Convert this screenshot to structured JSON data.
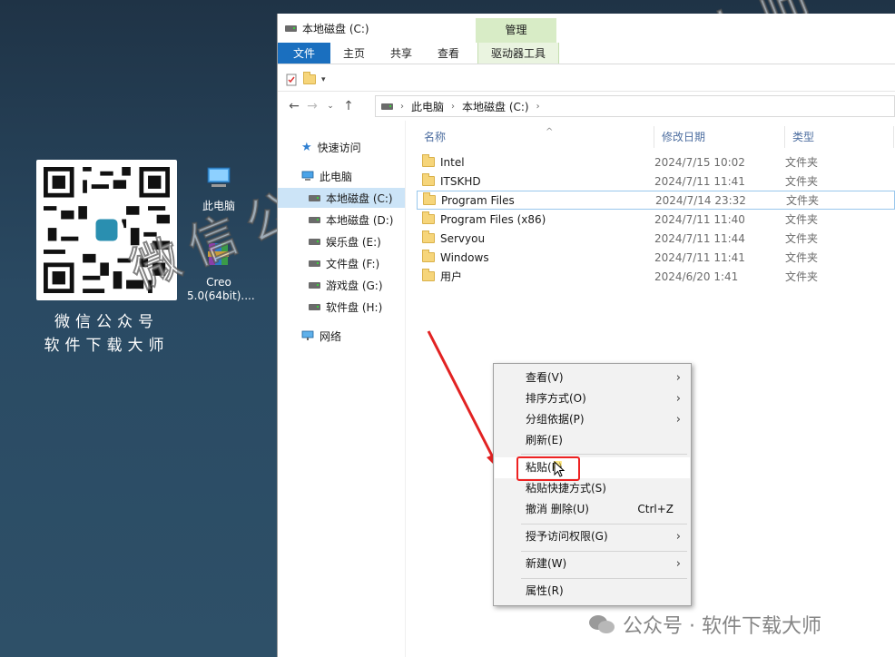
{
  "desktop": {
    "qr_caption_line1": "微信公众号",
    "qr_caption_line2": "软件下载大师",
    "icons": [
      {
        "label": "此电脑",
        "icon": "computer-icon"
      },
      {
        "label": "Creo 5.0(64bit)....",
        "icon": "winrar-archive-icon"
      }
    ],
    "watermark_text": "微信公众号：软件下载大师",
    "footer_watermark": "公众号 · 软件下载大师"
  },
  "window": {
    "title": "本地磁盘 (C:)",
    "context_tab_header": "管理",
    "ribbon_tabs": [
      "文件",
      "主页",
      "共享",
      "查看",
      "驱动器工具"
    ],
    "breadcrumb": [
      "此电脑",
      "本地磁盘 (C:)"
    ],
    "nav_items": [
      {
        "label": "快速访问",
        "icon": "star-icon"
      },
      {
        "label": "此电脑",
        "icon": "computer-icon"
      },
      {
        "label": "本地磁盘 (C:)",
        "icon": "drive-icon",
        "selected": true
      },
      {
        "label": "本地磁盘 (D:)",
        "icon": "drive-icon"
      },
      {
        "label": "娱乐盘 (E:)",
        "icon": "drive-icon"
      },
      {
        "label": "文件盘 (F:)",
        "icon": "drive-icon"
      },
      {
        "label": "游戏盘 (G:)",
        "icon": "drive-icon"
      },
      {
        "label": "软件盘 (H:)",
        "icon": "drive-icon"
      },
      {
        "label": "网络",
        "icon": "network-icon"
      }
    ],
    "columns": [
      "名称",
      "修改日期",
      "类型"
    ],
    "files": [
      {
        "name": "Intel",
        "date": "2024/7/15 10:02",
        "type": "文件夹"
      },
      {
        "name": "ITSKHD",
        "date": "2024/7/11 11:41",
        "type": "文件夹"
      },
      {
        "name": "Program Files",
        "date": "2024/7/14 23:32",
        "type": "文件夹"
      },
      {
        "name": "Program Files (x86)",
        "date": "2024/7/11 11:40",
        "type": "文件夹"
      },
      {
        "name": "Servyou",
        "date": "2024/7/11 11:44",
        "type": "文件夹"
      },
      {
        "name": "Windows",
        "date": "2024/7/11 11:41",
        "type": "文件夹"
      },
      {
        "name": "用户",
        "date": "2024/6/20 1:41",
        "type": "文件夹"
      }
    ]
  },
  "context_menu": {
    "items": [
      {
        "label": "查看(V)",
        "submenu": true
      },
      {
        "label": "排序方式(O)",
        "submenu": true
      },
      {
        "label": "分组依据(P)",
        "submenu": true
      },
      {
        "label": "刷新(E)"
      },
      {
        "label": "粘贴(P)",
        "highlighted": true
      },
      {
        "label": "粘贴快捷方式(S)"
      },
      {
        "label": "撤消 删除(U)",
        "shortcut": "Ctrl+Z"
      },
      {
        "label": "授予访问权限(G)",
        "submenu": true
      },
      {
        "label": "新建(W)",
        "submenu": true
      },
      {
        "label": "属性(R)"
      }
    ]
  },
  "colors": {
    "accent": "#1a6fbf",
    "context_tab": "#d8ecc6",
    "selection": "#cce4f7",
    "annotation_red": "#e22222"
  }
}
